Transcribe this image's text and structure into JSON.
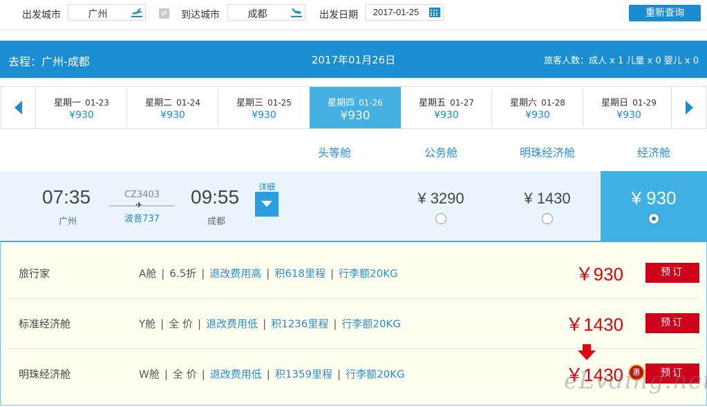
{
  "search": {
    "depart_label": "出发城市",
    "depart_value": "广州",
    "arrive_label": "到达城市",
    "arrive_value": "成都",
    "date_label": "出发日期",
    "date_value": "2017-01-25",
    "button_label": "重新查询"
  },
  "route": {
    "title": "去程：广州-成都",
    "date": "2017年01月26日",
    "passengers": "旅客人数：成人 x 1   儿童 x 0   婴儿 x 0"
  },
  "date_tabs": [
    {
      "day": "星期一",
      "date": "01-23",
      "price": "¥930"
    },
    {
      "day": "星期二",
      "date": "01-24",
      "price": "¥930"
    },
    {
      "day": "星期三",
      "date": "01-25",
      "price": "¥930"
    },
    {
      "day": "星期四",
      "date": "01-26",
      "price": "¥930"
    },
    {
      "day": "星期五",
      "date": "01-27",
      "price": "¥930"
    },
    {
      "day": "星期六",
      "date": "01-28",
      "price": "¥930"
    },
    {
      "day": "星期日",
      "date": "01-29",
      "price": "¥930"
    }
  ],
  "cabins": {
    "first": "头等舱",
    "business": "公务舱",
    "pearl": "明珠经济舱",
    "economy": "经济舱"
  },
  "flight": {
    "dep_time": "07:35",
    "dep_city": "广州",
    "flight_no": "CZ3403",
    "aircraft": "波音737",
    "arr_time": "09:55",
    "arr_city": "成都",
    "detail_label": "详细",
    "business_price": "¥ 3290",
    "pearl_price": "¥ 1430",
    "economy_price": "¥ 930"
  },
  "fares": [
    {
      "name": "旅行家",
      "cabin": "A舱",
      "discount": "6.5折",
      "change_fee": "退改费用高",
      "miles": "积618里程",
      "baggage": "行李额20KG",
      "price": "￥930",
      "book": "预订"
    },
    {
      "name": "标准经济舱",
      "cabin": "Y舱",
      "discount": "全 价",
      "change_fee": "退改费用低",
      "miles": "积1236里程",
      "baggage": "行李额20KG",
      "price": "￥1430",
      "book": "预订"
    },
    {
      "name": "明珠经济舱",
      "cabin": "W舱",
      "discount": "全 价",
      "change_fee": "退改费用低",
      "miles": "积1359里程",
      "baggage": "行李额20KG",
      "price": "￥1430",
      "book": "预订"
    }
  ],
  "promo_badge": "惠",
  "watermark": "eLvding.net",
  "colors": {
    "brand_blue": "#1a8ed1",
    "active_tab": "#45b1e3",
    "book_red": "#d0021b",
    "price_red": "#d8000f"
  }
}
